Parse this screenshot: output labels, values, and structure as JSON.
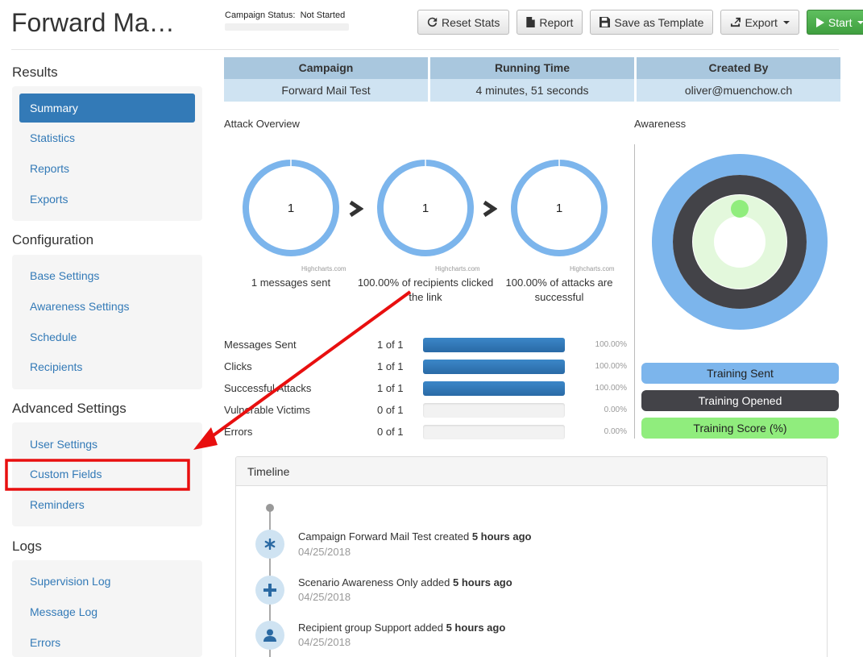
{
  "header": {
    "title": "Forward Ma…",
    "campaign_status_label": "Campaign Status:",
    "campaign_status_value": "Not Started"
  },
  "toolbar": {
    "reset_label": "Reset Stats",
    "report_label": "Report",
    "save_template_label": "Save as Template",
    "export_label": "Export",
    "start_label": "Start"
  },
  "sidebar": {
    "results": {
      "heading": "Results",
      "items": [
        "Summary",
        "Statistics",
        "Reports",
        "Exports"
      ]
    },
    "configuration": {
      "heading": "Configuration",
      "items": [
        "Base Settings",
        "Awareness Settings",
        "Schedule",
        "Recipients"
      ]
    },
    "advanced": {
      "heading": "Advanced Settings",
      "items": [
        "User Settings",
        "Custom Fields",
        "Reminders"
      ]
    },
    "logs": {
      "heading": "Logs",
      "items": [
        "Supervision Log",
        "Message Log",
        "Errors"
      ]
    }
  },
  "info": {
    "headers": [
      "Campaign",
      "Running Time",
      "Created By"
    ],
    "values": [
      "Forward Mail Test",
      "4 minutes, 51 seconds",
      "oliver@muenchow.ch"
    ]
  },
  "overview": {
    "title": "Attack Overview",
    "credit": "Highcharts.com",
    "donuts": [
      {
        "value": "1",
        "caption": "1 messages sent"
      },
      {
        "value": "1",
        "caption": "100.00% of recipients clicked the link"
      },
      {
        "value": "1",
        "caption": "100.00% of attacks are successful"
      }
    ]
  },
  "stats": [
    {
      "label": "Messages Sent",
      "count": "1 of 1",
      "fraction": 1.0,
      "pct": "100.00%"
    },
    {
      "label": "Clicks",
      "count": "1 of 1",
      "fraction": 1.0,
      "pct": "100.00%"
    },
    {
      "label": "Successful Attacks",
      "count": "1 of 1",
      "fraction": 1.0,
      "pct": "100.00%"
    },
    {
      "label": "Vulnerable Victims",
      "count": "0 of 1",
      "fraction": 0.0,
      "pct": "0.00%"
    },
    {
      "label": "Errors",
      "count": "0 of 1",
      "fraction": 0.0,
      "pct": "0.00%"
    }
  ],
  "awareness": {
    "title": "Awareness",
    "legend": [
      "Training Sent",
      "Training Opened",
      "Training Score (%)"
    ],
    "colors": {
      "sent": "#7cb5ec",
      "opened": "#434348",
      "score": "#90ed7d"
    }
  },
  "timeline": {
    "title": "Timeline",
    "events": [
      {
        "text": "Campaign Forward Mail Test created",
        "when": "5 hours ago",
        "date": "04/25/2018",
        "icon": "asterisk-icon"
      },
      {
        "text": "Scenario Awareness Only added",
        "when": "5 hours ago",
        "date": "04/25/2018",
        "icon": "plus-icon"
      },
      {
        "text": "Recipient group Support added",
        "when": "5 hours ago",
        "date": "04/25/2018",
        "icon": "user-icon"
      }
    ]
  },
  "colors": {
    "primary": "#337ab7",
    "success": "#4cae4c",
    "highlight": "#e80f0f"
  }
}
